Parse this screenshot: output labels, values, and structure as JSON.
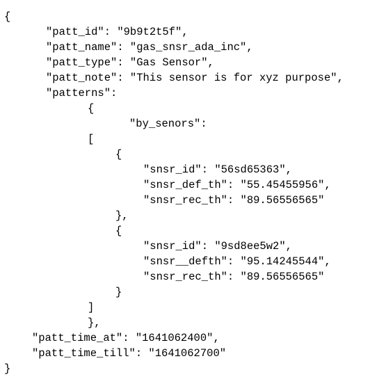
{
  "lines": [
    "{",
    "\"patt_id\": \"9b9t2t5f\",",
    "\"patt_name\": \"gas_snsr_ada_inc\",",
    "\"patt_type\": \"Gas Sensor\",",
    "\"patt_note\": \"This sensor is for xyz purpose\",",
    "\"patterns\":",
    "{",
    "\"by_senors\":",
    "[",
    "{",
    "\"snsr_id\": \"56sd65363\",",
    "\"snsr_def_th\": \"55.45455956\",",
    "\"snsr_rec_th\": \"89.56556565\"",
    "},",
    "{",
    "\"snsr_id\": \"9sd8ee5w2\",",
    "\"snsr__defth\": \"95.14245544\",",
    "\"snsr_rec_th\": \"89.56556565\"",
    "}",
    "]",
    "},",
    "\"patt_time_at\": \"1641062400\",",
    "\"patt_time_till\": \"1641062700\"",
    "}"
  ]
}
